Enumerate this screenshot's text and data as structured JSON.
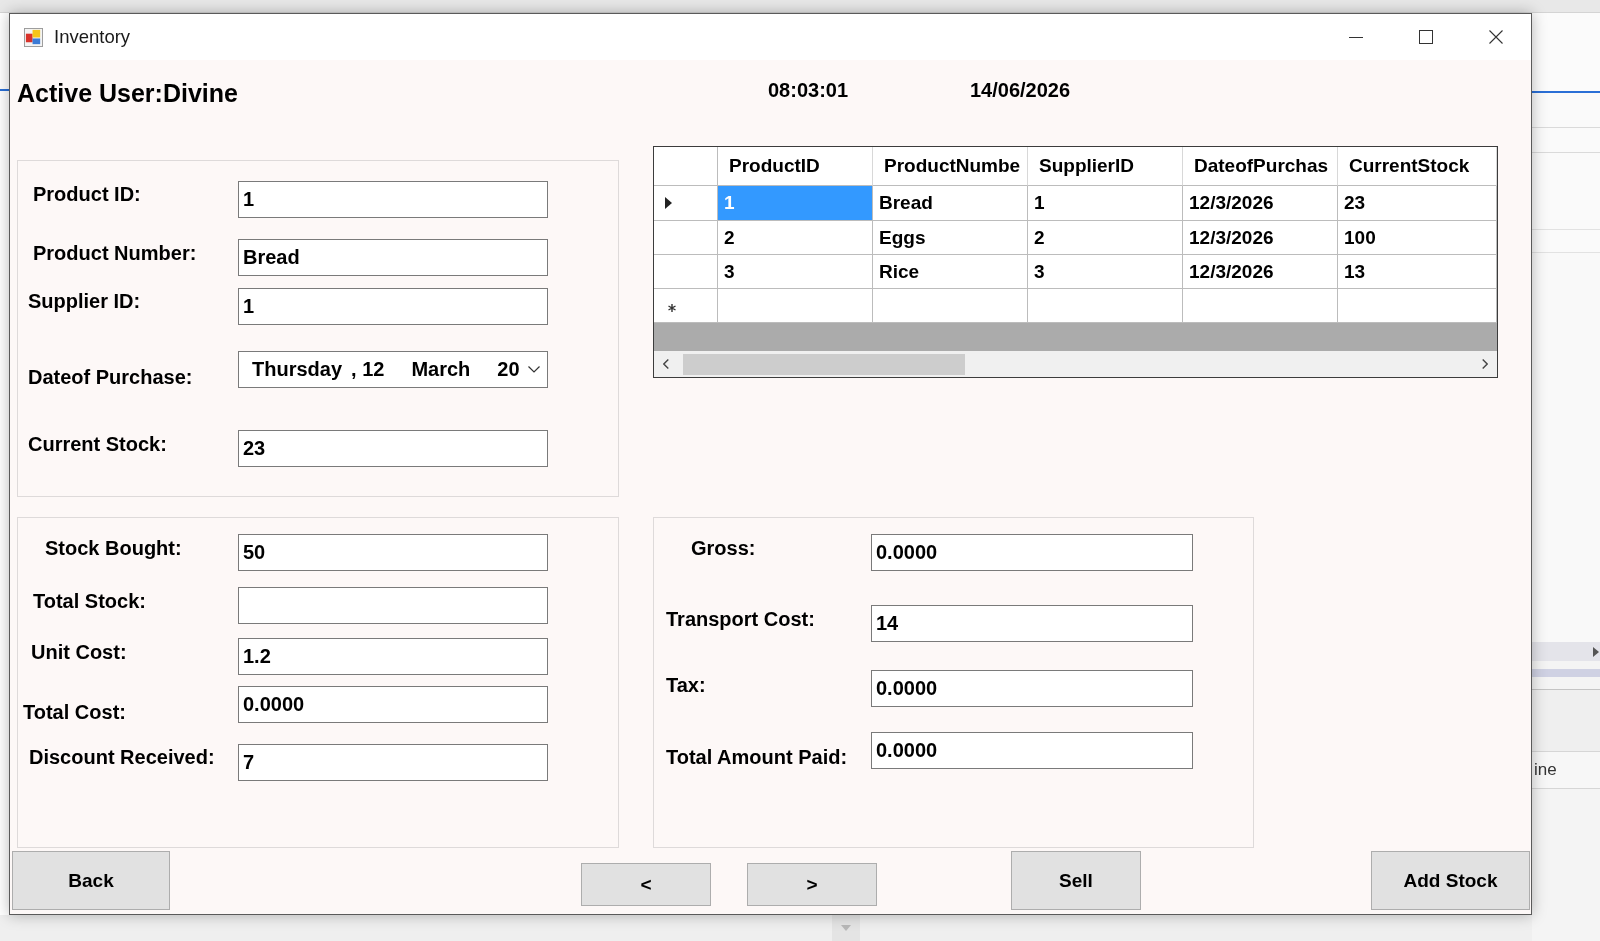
{
  "window": {
    "title": "Inventory"
  },
  "header": {
    "active_user": "Active User:Divine",
    "time": "08:03:01",
    "date": "14/06/2026"
  },
  "product_group": {
    "fields": [
      {
        "label": "Product ID:",
        "kind": "text",
        "value": "1"
      },
      {
        "label": "Product Number:",
        "kind": "text",
        "value": "Bread"
      },
      {
        "label": "Supplier ID:",
        "kind": "text",
        "value": "1"
      },
      {
        "label": "Dateof Purchase:",
        "kind": "date",
        "value_parts": [
          "Thursday",
          ", 12",
          "March",
          "20"
        ]
      },
      {
        "label": "Current Stock:",
        "kind": "text",
        "value": "23"
      }
    ]
  },
  "table": {
    "columns": [
      "ProductID",
      "ProductNumbe",
      "SupplierID",
      "DateofPurchas",
      "CurrentStock"
    ],
    "rows": [
      {
        "current": true,
        "cells": [
          {
            "text": "1",
            "selected": true
          },
          {
            "text": "Bread",
            "selected": false
          },
          {
            "text": "1",
            "selected": false
          },
          {
            "text": "12/3/2026",
            "selected": false
          },
          {
            "text": "23",
            "selected": false
          }
        ]
      },
      {
        "current": false,
        "cells": [
          {
            "text": "2",
            "selected": false
          },
          {
            "text": "Eggs",
            "selected": false
          },
          {
            "text": "2",
            "selected": false
          },
          {
            "text": "12/3/2026",
            "selected": false
          },
          {
            "text": "100",
            "selected": false
          }
        ]
      },
      {
        "current": false,
        "cells": [
          {
            "text": "3",
            "selected": false
          },
          {
            "text": "Rice",
            "selected": false
          },
          {
            "text": "3",
            "selected": false
          },
          {
            "text": "12/3/2026",
            "selected": false
          },
          {
            "text": "13",
            "selected": false
          }
        ]
      }
    ],
    "new_row": true
  },
  "stock_group": {
    "fields": [
      {
        "label": "Stock Bought:",
        "kind": "text",
        "value": "50"
      },
      {
        "label": "Total Stock:",
        "kind": "text"
      },
      {
        "label": "Unit Cost:",
        "kind": "text",
        "value": "1.2"
      },
      {
        "label": "Total Cost:",
        "kind": "text",
        "value": "0.0000"
      },
      {
        "label": "Discount Received:",
        "kind": "text",
        "value": "7"
      }
    ]
  },
  "payment_group": {
    "fields": [
      {
        "label": "Gross:",
        "kind": "text",
        "value": "0.0000"
      },
      {
        "label": "Transport Cost:",
        "kind": "text",
        "value": "14"
      },
      {
        "label": "Tax:",
        "kind": "text",
        "value": "0.0000"
      },
      {
        "label": "Total Amount Paid:",
        "kind": "text",
        "value": "0.0000"
      }
    ]
  },
  "buttons": [
    {
      "label": "Back",
      "kind": "action"
    },
    {
      "label": "<",
      "kind": "nav"
    },
    {
      "label": ">",
      "kind": "nav"
    },
    {
      "label": "Sell",
      "kind": "action"
    },
    {
      "label": "Add Stock",
      "kind": "action"
    }
  ],
  "background": {
    "panel_text": "ine"
  }
}
